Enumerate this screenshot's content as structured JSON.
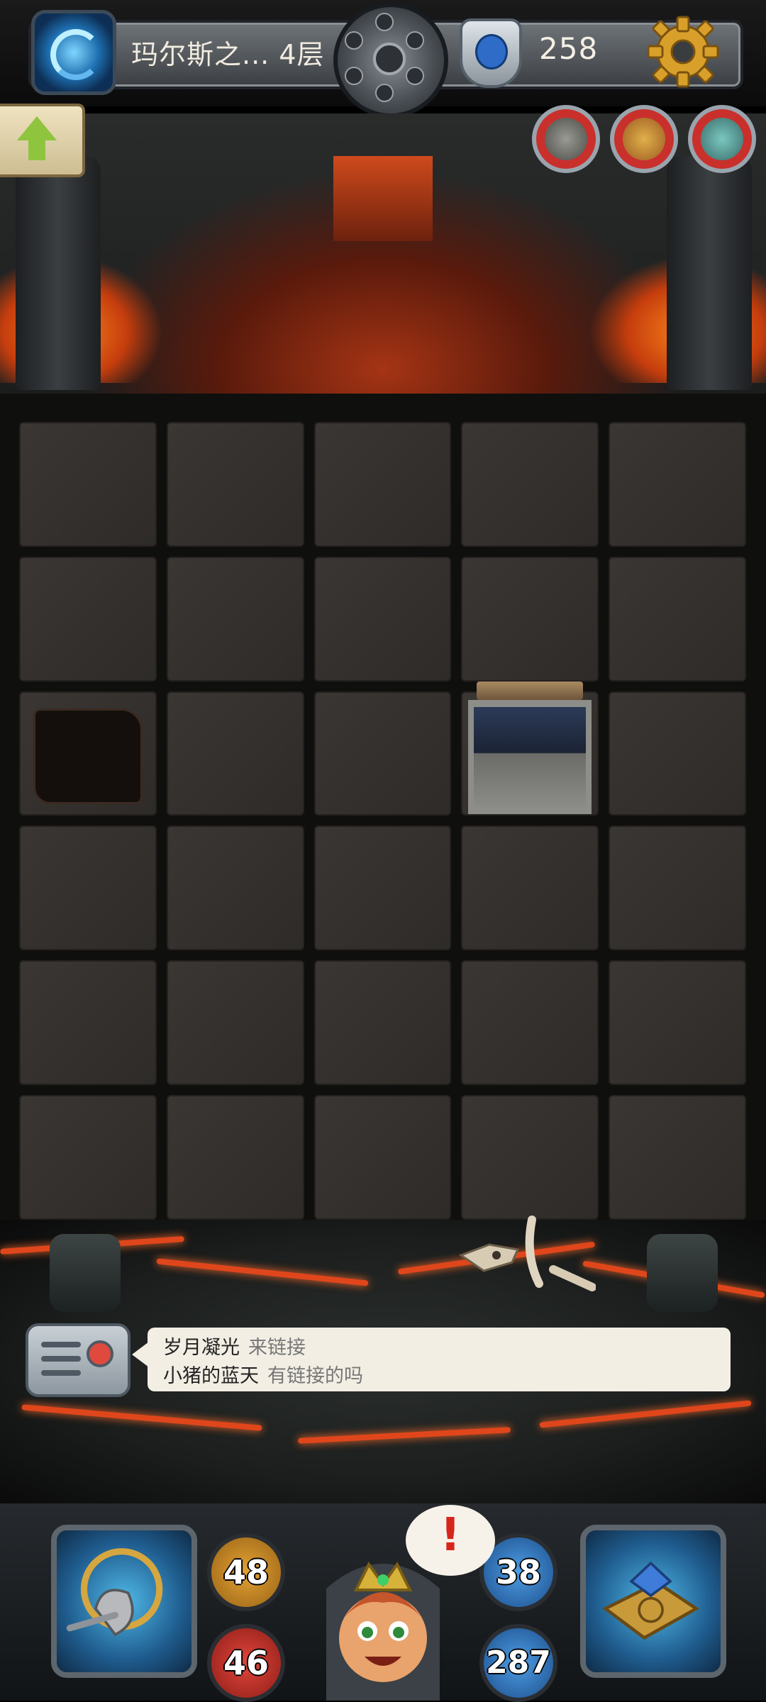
{
  "header": {
    "floor_name": "玛尔斯之... 4层",
    "gem_count": "258"
  },
  "chat": {
    "messages": [
      {
        "user": "岁月凝光",
        "text": "来链接"
      },
      {
        "user": "小猪的蓝天",
        "text": "有链接的吗"
      }
    ]
  },
  "stats": {
    "attack": "48",
    "hp": "46",
    "defense": "38",
    "mana": "287"
  },
  "alert_mark": "!",
  "icons": {
    "portal": "portal-swirl-icon",
    "gem": "gem-crest-icon",
    "settings": "gear-icon",
    "up": "up-arrow-icon",
    "chat": "radio-icon"
  },
  "colors": {
    "lava": "#e0461b",
    "tile": "#34302d",
    "chat_bg": "#f2eee4",
    "attack": "#e2a234",
    "hp": "#e0463c",
    "defense": "#4e9de4"
  }
}
